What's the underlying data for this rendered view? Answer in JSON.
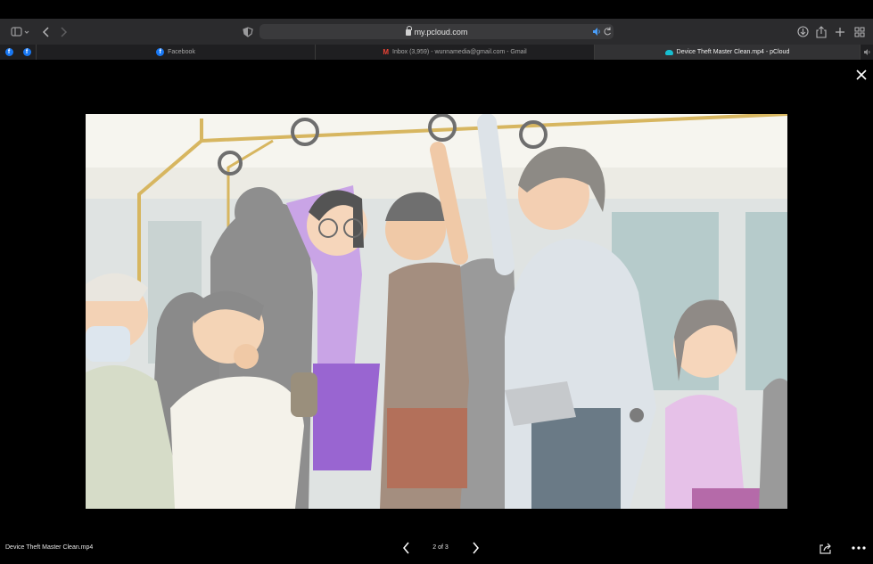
{
  "browser": {
    "address": "my.pcloud.com",
    "tabs": [
      {
        "label": "Facebook",
        "icon": "facebook-icon",
        "active": false
      },
      {
        "label": "Inbox (3,959) - wunnamedia@gmail.com - Gmail",
        "icon": "gmail-icon",
        "active": false
      },
      {
        "label": "Device Theft Master Clean.mp4 - pCloud",
        "icon": "pcloud-icon",
        "active": true
      }
    ]
  },
  "viewer": {
    "filename": "Device Theft Master Clean.mp4",
    "pager": "2 of 3"
  },
  "colors": {
    "toolbar_bg": "#2b2b2d",
    "tabbar_bg": "#1f1f21",
    "viewer_bg": "#000000",
    "facebook_blue": "#1877f2",
    "pcloud_teal": "#17bed0"
  }
}
